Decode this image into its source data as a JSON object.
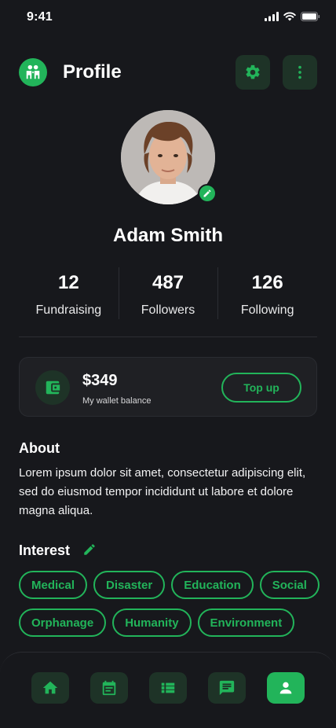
{
  "status_bar": {
    "time": "9:41"
  },
  "header": {
    "title": "Profile"
  },
  "profile": {
    "name": "Adam Smith"
  },
  "stats": [
    {
      "value": "12",
      "label": "Fundraising"
    },
    {
      "value": "487",
      "label": "Followers"
    },
    {
      "value": "126",
      "label": "Following"
    }
  ],
  "wallet": {
    "amount": "$349",
    "label": "My wallet balance",
    "button_label": "Top up"
  },
  "about": {
    "title": "About",
    "text": "Lorem ipsum dolor sit amet, consectetur adipiscing elit, sed do eiusmod tempor incididunt ut labore et dolore magna aliqua."
  },
  "interest": {
    "title": "Interest",
    "tags": [
      "Medical",
      "Disaster",
      "Education",
      "Social",
      "Orphanage",
      "Humanity",
      "Environment"
    ]
  },
  "bottom_nav": [
    {
      "icon": "home-icon",
      "active": false
    },
    {
      "icon": "calendar-icon",
      "active": false
    },
    {
      "icon": "list-icon",
      "active": false
    },
    {
      "icon": "message-icon",
      "active": false
    },
    {
      "icon": "profile-icon",
      "active": true
    }
  ],
  "colors": {
    "accent": "#22b45a",
    "background": "#17181c",
    "card": "#1f2024",
    "icon_bg": "#1e3327"
  }
}
